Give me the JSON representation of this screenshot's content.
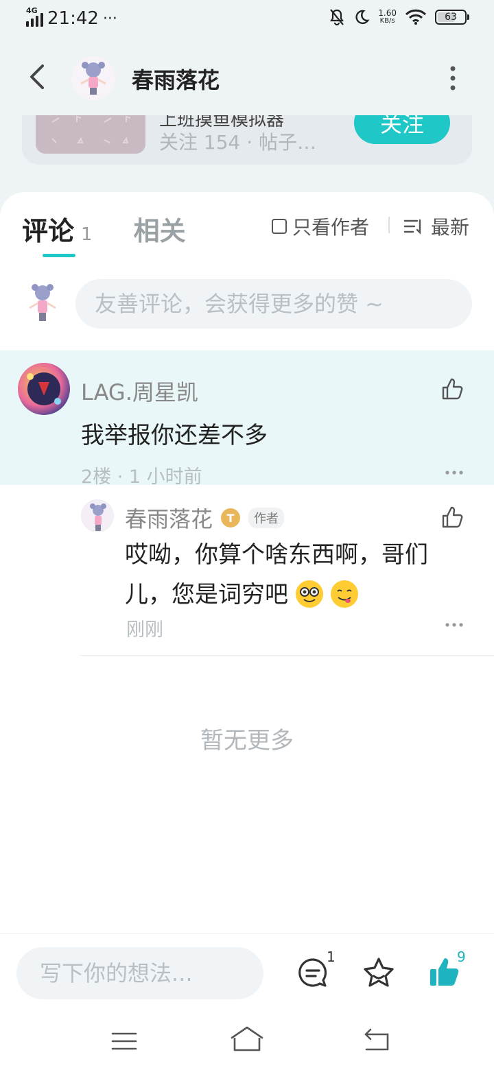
{
  "status_bar": {
    "network": "4G",
    "time": "21:42",
    "dots": "···",
    "speed_top": "1.60",
    "speed_unit": "KB/s",
    "battery": "63"
  },
  "header": {
    "title": "春雨落花"
  },
  "peek_card": {
    "title": "上班摸鱼模拟器",
    "meta": "关注 154 · 帖子…",
    "follow_label": "关注"
  },
  "tabs": {
    "comments_label": "评论",
    "comments_count": "1",
    "related_label": "相关",
    "only_author_label": "只看作者",
    "sort_label": "最新"
  },
  "comment_input": {
    "placeholder": "友善评论，会获得更多的赞 ~"
  },
  "comments": [
    {
      "user": "LAG.周星凯",
      "text": "我举报你还差不多",
      "meta": "2楼 · 1 小时前",
      "reply": {
        "user": "春雨落花",
        "level_badge": "T",
        "author_badge": "作者",
        "text": "哎呦，你算个啥东西啊，哥们儿，您是词穷吧",
        "meta": "刚刚"
      }
    }
  ],
  "no_more_text": "暂无更多",
  "bottom_bar": {
    "placeholder": "写下你的想法...",
    "comment_count": "1",
    "like_count": "9"
  },
  "colors": {
    "accent": "#1fc7c7",
    "highlight_bg": "#e9f7f9"
  }
}
